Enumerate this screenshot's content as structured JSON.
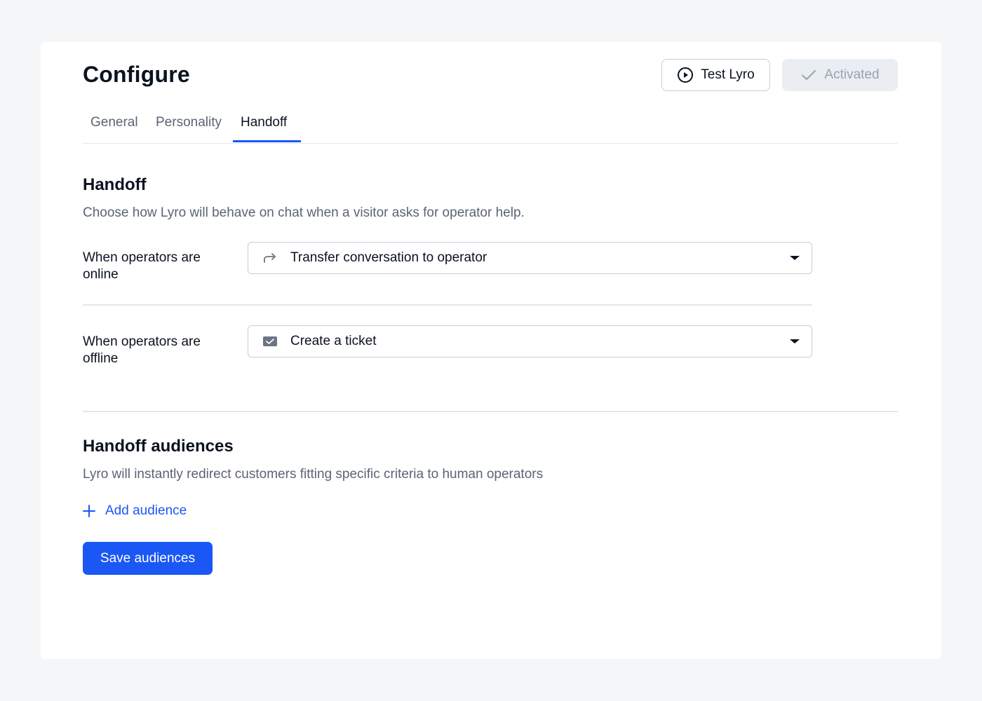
{
  "header": {
    "title": "Configure",
    "test_button_label": "Test Lyro",
    "activated_button_label": "Activated"
  },
  "tabs": [
    {
      "label": "General",
      "active": false
    },
    {
      "label": "Personality",
      "active": false
    },
    {
      "label": "Handoff",
      "active": true
    }
  ],
  "handoff": {
    "title": "Handoff",
    "description": "Choose how Lyro will behave on chat when a visitor asks for operator help.",
    "online": {
      "label": "When operators are online",
      "selected_value": "Transfer conversation to operator",
      "icon": "forward-arrow-icon"
    },
    "offline": {
      "label": "When operators are offline",
      "selected_value": "Create a ticket",
      "icon": "ticket-icon"
    }
  },
  "audiences": {
    "title": "Handoff audiences",
    "description": "Lyro will instantly redirect customers fitting specific criteria to human operators",
    "add_label": "Add audience",
    "save_label": "Save audiences"
  },
  "colors": {
    "accent": "#1a57f5",
    "page_background": "#f5f6f8",
    "muted_text": "#5b6474",
    "disabled_text": "#9aa3b2"
  }
}
